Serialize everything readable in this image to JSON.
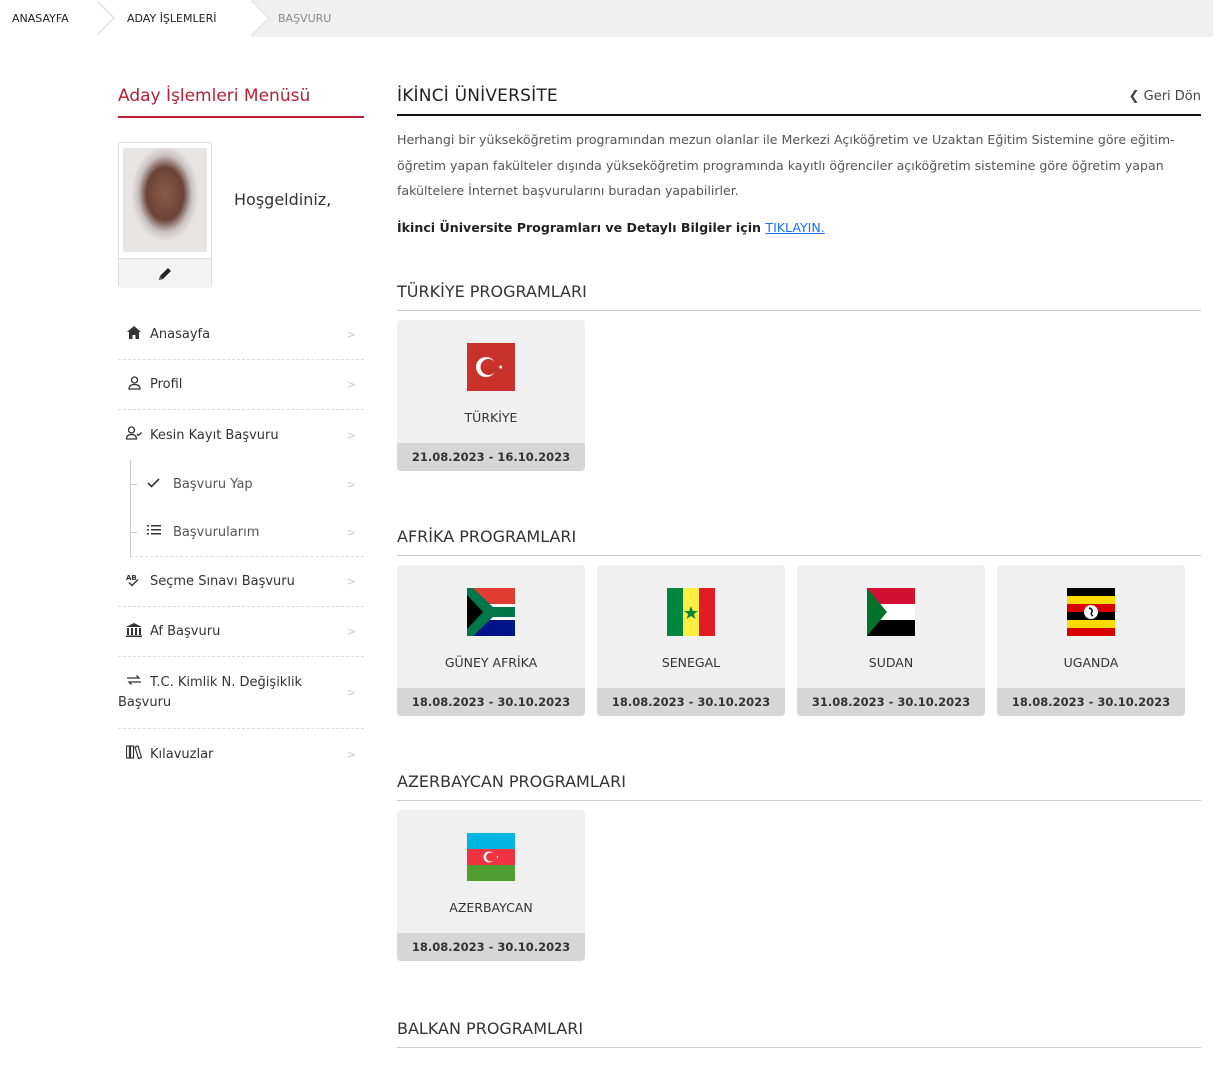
{
  "breadcrumb": {
    "home": "ANASAYFA",
    "section": "ADAY İŞLEMLERİ",
    "current": "BAŞVURU"
  },
  "sidebar": {
    "title": "Aday İşlemleri Menüsü",
    "welcome": "Hoşgeldiniz,",
    "edit_icon": "pencil-icon",
    "items": [
      {
        "label": "Anasayfa",
        "icon": "home-icon"
      },
      {
        "label": "Profil",
        "icon": "user-icon"
      },
      {
        "label": "Kesin Kayıt Başvuru",
        "icon": "user-check-icon"
      },
      {
        "label": "Başvuru Yap",
        "icon": "check-icon"
      },
      {
        "label": "Başvurularım",
        "icon": "list-icon"
      },
      {
        "label": "Seçme Sınavı Başvuru",
        "icon": "spellcheck-icon"
      },
      {
        "label": "Af Başvuru",
        "icon": "building-icon"
      },
      {
        "label": "T.C. Kimlik N. Değişiklik",
        "label2": "Başvuru",
        "icon": "exchange-icon"
      },
      {
        "label": "Kılavuzlar",
        "icon": "book-icon"
      }
    ]
  },
  "main": {
    "title": "İKİNCİ ÜNİVERSİTE",
    "back": "Geri Dön",
    "description": "Herhangi bir yükseköğretim programından mezun olanlar ile Merkezi Açıköğretim ve Uzaktan Eğitim Sistemine göre eğitim-öğretim yapan fakülteler dışında yükseköğretim programında kayıtlı öğrenciler açıköğretim sistemine göre öğretim yapan fakültelere İnternet başvurularını buradan yapabilirler.",
    "info_prefix": "İkinci Üniversite Programları ve Detaylı Bilgiler için",
    "info_link": "TIKLAYIN.",
    "sections": [
      {
        "title": "TÜRKİYE PROGRAMLARI",
        "cards": [
          {
            "name": "TÜRKİYE",
            "dates": "21.08.2023 - 16.10.2023"
          }
        ]
      },
      {
        "title": "AFRİKA PROGRAMLARI",
        "cards": [
          {
            "name": "GÜNEY AFRİKA",
            "dates": "18.08.2023 - 30.10.2023"
          },
          {
            "name": "SENEGAL",
            "dates": "18.08.2023 - 30.10.2023"
          },
          {
            "name": "SUDAN",
            "dates": "31.08.2023 - 30.10.2023"
          },
          {
            "name": "UGANDA",
            "dates": "18.08.2023 - 30.10.2023"
          }
        ]
      },
      {
        "title": "AZERBAYCAN PROGRAMLARI",
        "cards": [
          {
            "name": "AZERBAYCAN",
            "dates": "18.08.2023 - 30.10.2023"
          }
        ]
      },
      {
        "title": "BALKAN PROGRAMLARI",
        "cards": []
      }
    ]
  },
  "colors": {
    "accent": "#b22234",
    "link": "#1a73e8",
    "card_bg": "#f0f0f0",
    "card_date_bg": "#d6d6d6"
  }
}
